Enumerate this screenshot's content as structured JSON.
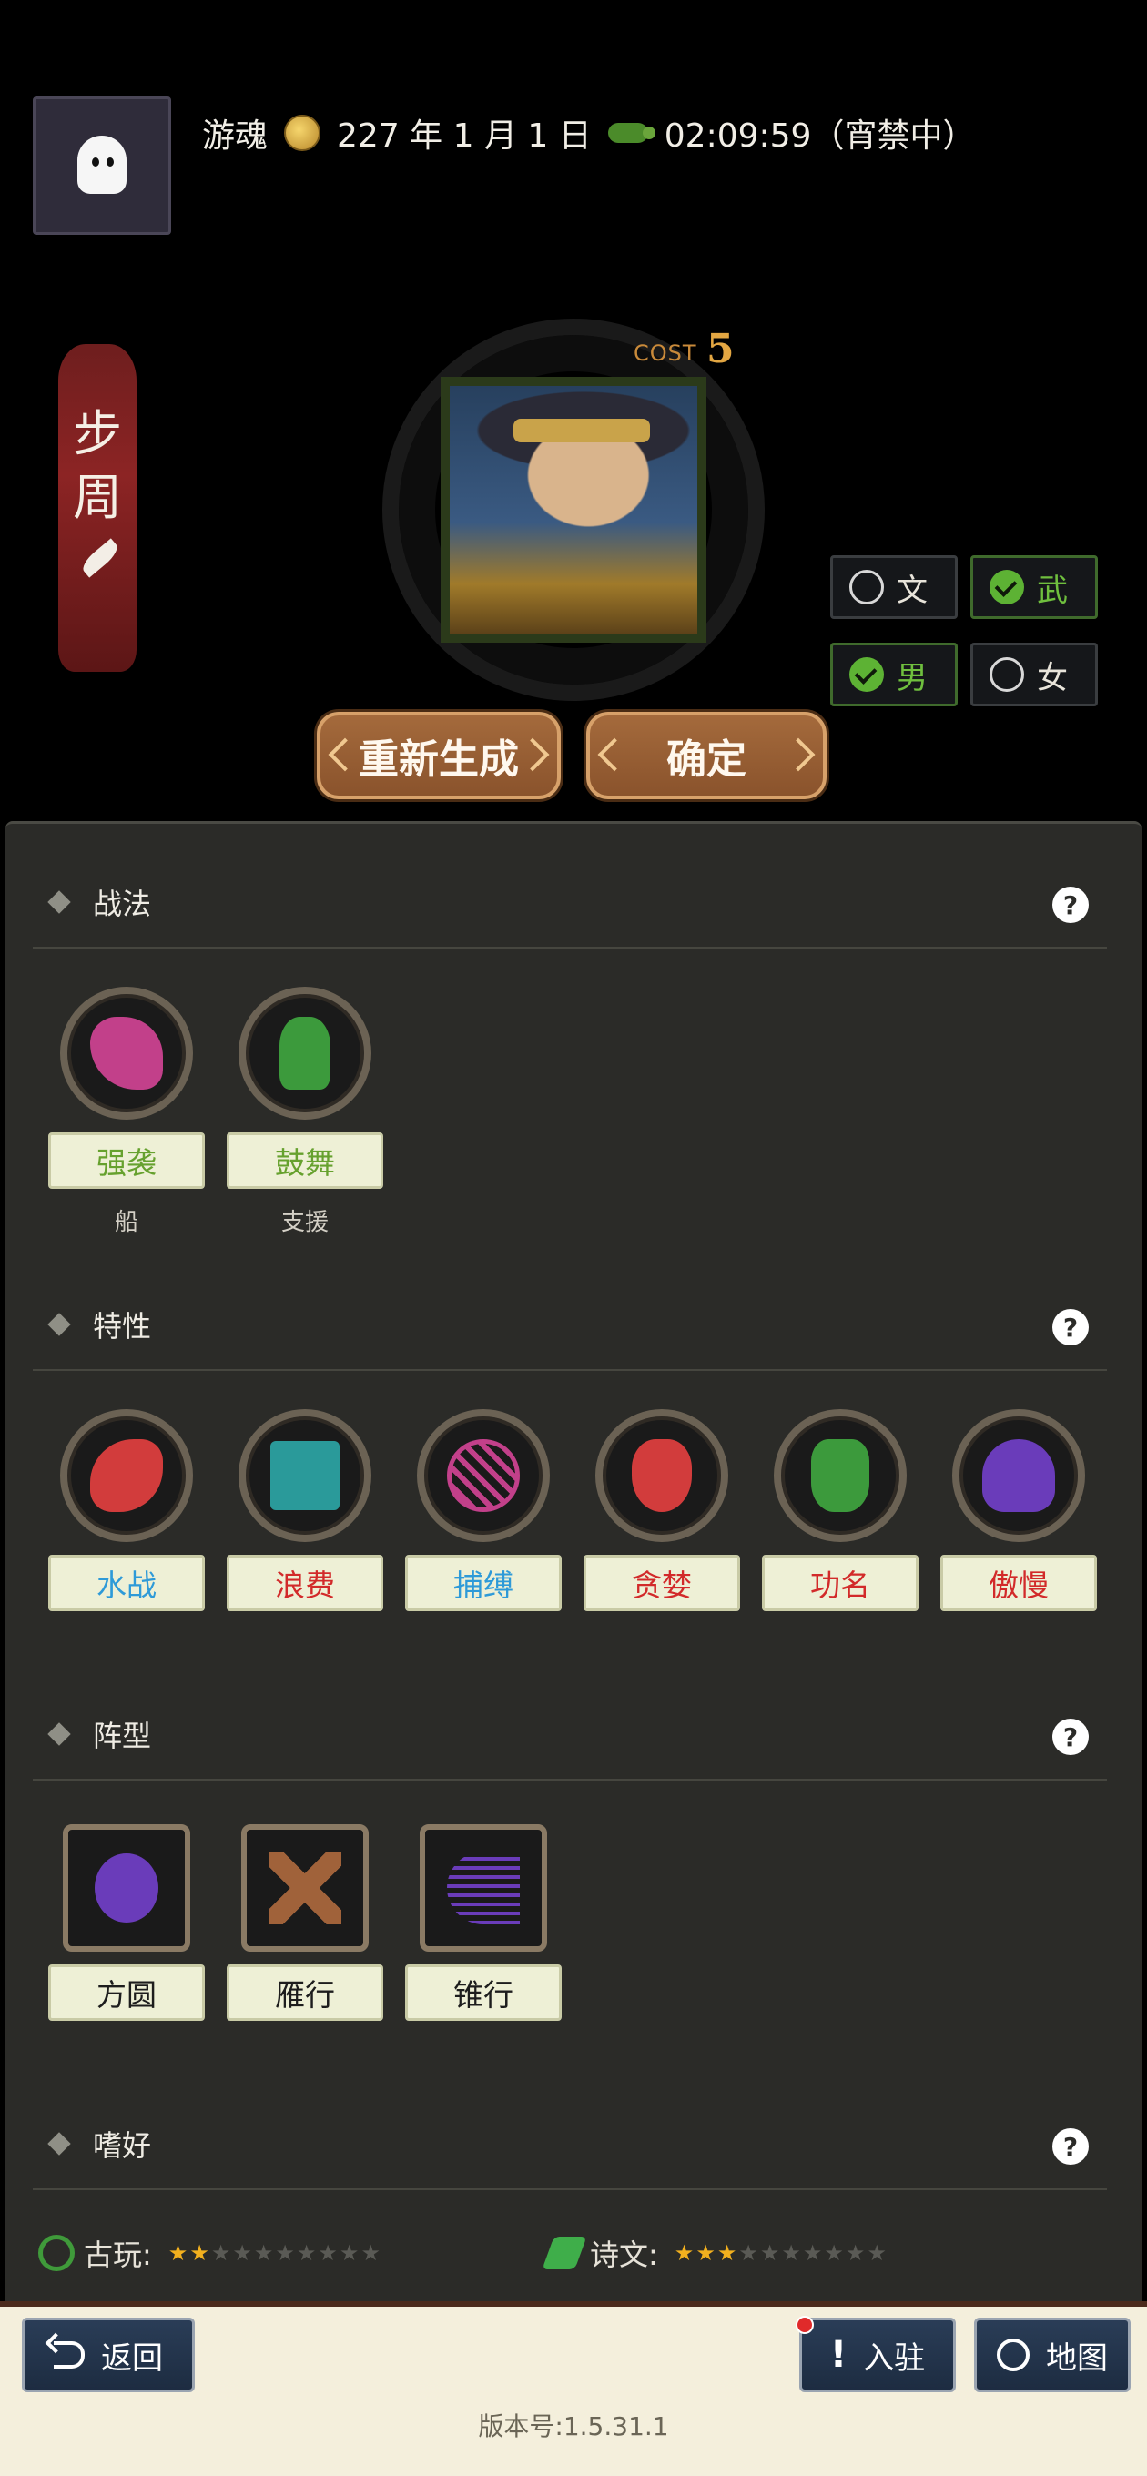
{
  "header": {
    "username": "游魂",
    "date": "227 年 1 月 1 日",
    "time": "02:09:59（宵禁中）"
  },
  "hero": {
    "name_chars": [
      "步",
      "周"
    ],
    "cost_label": "COST",
    "cost_value": "5"
  },
  "toggles": {
    "wen": {
      "label": "文",
      "checked": false
    },
    "wu": {
      "label": "武",
      "checked": true
    },
    "male": {
      "label": "男",
      "checked": true
    },
    "female": {
      "label": "女",
      "checked": false
    }
  },
  "buttons": {
    "regenerate": "重新生成",
    "confirm": "确定"
  },
  "sections": {
    "tactics": {
      "title": "战法",
      "items": [
        {
          "label": "强袭",
          "sub": "船",
          "icon": "assault-icon",
          "color": "#c2408a"
        },
        {
          "label": "鼓舞",
          "sub": "支援",
          "icon": "inspire-icon",
          "color": "#3c9a3c"
        }
      ]
    },
    "traits": {
      "title": "特性",
      "items": [
        {
          "label": "水战",
          "icon": "naval-icon",
          "color": "#d23c3c"
        },
        {
          "label": "浪费",
          "icon": "waste-icon",
          "color": "#2a9a9a"
        },
        {
          "label": "捕缚",
          "icon": "net-icon",
          "color": "#c2408a"
        },
        {
          "label": "贪婪",
          "icon": "greedy-mask-icon",
          "color": "#d23c3c"
        },
        {
          "label": "功名",
          "icon": "fame-icon",
          "color": "#3c9a3c"
        },
        {
          "label": "傲慢",
          "icon": "arrogant-icon",
          "color": "#6a3cba"
        }
      ]
    },
    "formations": {
      "title": "阵型",
      "items": [
        {
          "label": "方圆",
          "icon": "turtle-icon",
          "color": "#6a3cba"
        },
        {
          "label": "雁行",
          "icon": "wings-icon",
          "color": "#a0623a"
        },
        {
          "label": "锥行",
          "icon": "cone-icon",
          "color": "#6a3cba"
        }
      ]
    },
    "hobbies": {
      "title": "嗜好",
      "items": [
        {
          "label": "古玩:",
          "icon": "jade-icon",
          "stars": 2,
          "max": 10
        },
        {
          "label": "诗文:",
          "icon": "scroll-icon",
          "stars": 3,
          "max": 10
        }
      ]
    }
  },
  "nav": {
    "back": "返回",
    "settle": "入驻",
    "map": "地图"
  },
  "version": "版本号:1.5.31.1"
}
